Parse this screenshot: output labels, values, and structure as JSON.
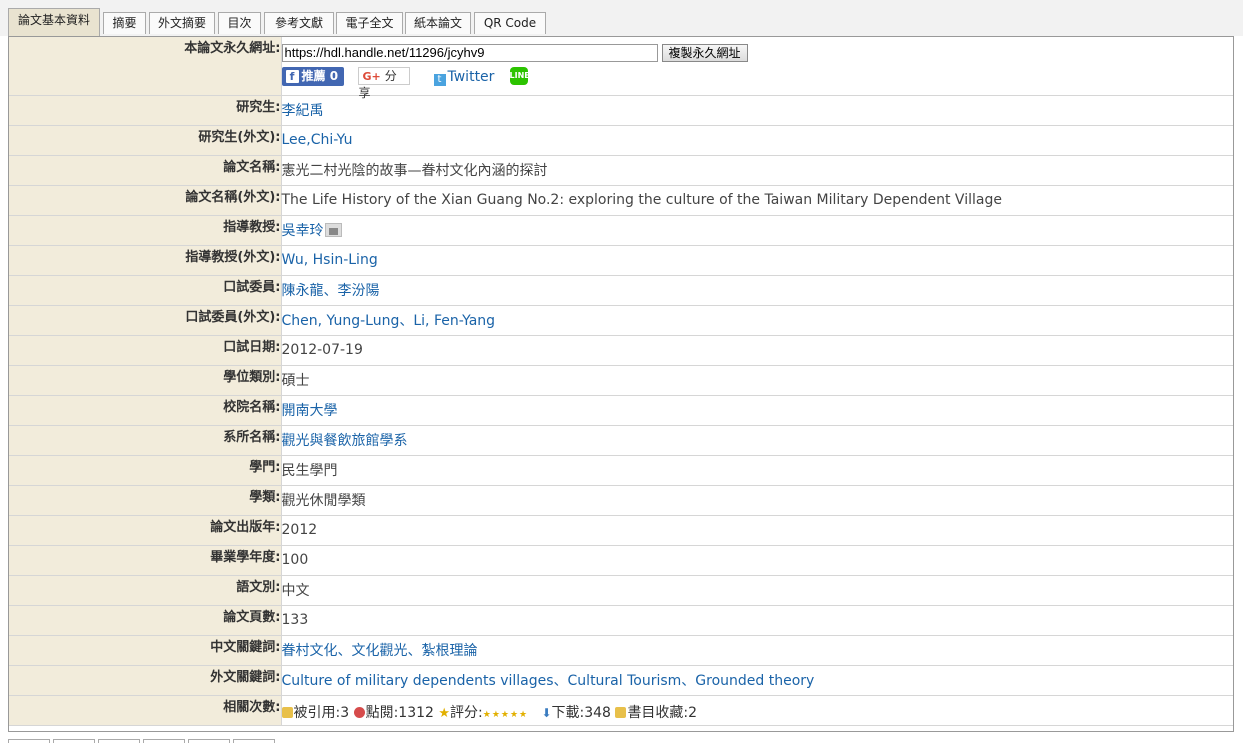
{
  "tabs": [
    {
      "label": "論文基本資料",
      "active": true
    },
    {
      "label": "摘要"
    },
    {
      "label": "外文摘要"
    },
    {
      "label": "目次"
    },
    {
      "label": "參考文獻"
    },
    {
      "label": "電子全文"
    },
    {
      "label": "紙本論文"
    },
    {
      "label": "QR Code"
    }
  ],
  "permalink": {
    "label": "本論文永久網址:",
    "url": "https://hdl.handle.net/11296/jcyhv9",
    "copy_button": "複製永久網址",
    "share": {
      "facebook": "推薦",
      "facebook_count": "0",
      "google": "分享",
      "twitter": "Twitter"
    }
  },
  "fields": [
    {
      "label": "研究生:",
      "value": "李紀禹",
      "link": true
    },
    {
      "label": "研究生(外文):",
      "value": "Lee,Chi-Yu",
      "link": true
    },
    {
      "label": "論文名稱:",
      "value": "憲光二村光陰的故事—眷村文化內涵的探討",
      "link": false
    },
    {
      "label": "論文名稱(外文):",
      "value": "The Life History of the Xian Guang No.2: exploring the culture of the Taiwan Military Dependent Village",
      "link": false
    },
    {
      "label": "指導教授:",
      "value": "吳幸玲",
      "link": true,
      "icon": "advisor-photo-icon"
    },
    {
      "label": "指導教授(外文):",
      "value": "Wu, Hsin-Ling",
      "link": true
    },
    {
      "label": "口試委員:",
      "value": "陳永龍、李汾陽",
      "link": true
    },
    {
      "label": "口試委員(外文):",
      "value": "Chen, Yung-Lung、Li, Fen-Yang",
      "link": true
    },
    {
      "label": "口試日期:",
      "value": "2012-07-19",
      "link": false
    },
    {
      "label": "學位類別:",
      "value": "碩士",
      "link": false
    },
    {
      "label": "校院名稱:",
      "value": "開南大學",
      "link": true
    },
    {
      "label": "系所名稱:",
      "value": "觀光與餐飲旅館學系",
      "link": true
    },
    {
      "label": "學門:",
      "value": "民生學門",
      "link": false
    },
    {
      "label": "學類:",
      "value": "觀光休閒學類",
      "link": false
    },
    {
      "label": "論文出版年:",
      "value": "2012",
      "link": false
    },
    {
      "label": "畢業學年度:",
      "value": "100",
      "link": false
    },
    {
      "label": "語文別:",
      "value": "中文",
      "link": false
    },
    {
      "label": "論文頁數:",
      "value": "133",
      "link": false
    },
    {
      "label": "中文關鍵詞:",
      "value": "眷村文化、文化觀光、紮根理論",
      "link": true
    },
    {
      "label": "外文關鍵詞:",
      "value": "Culture of military dependents villages、Cultural Tourism、Grounded theory",
      "link": true
    }
  ],
  "stats": {
    "label": "相關次數:",
    "cited": "被引用:3",
    "views": "點閱:1312",
    "rating": "評分:",
    "rating_stars": 5,
    "downloads": "下載:348",
    "bookmarks": "書目收藏:2"
  }
}
